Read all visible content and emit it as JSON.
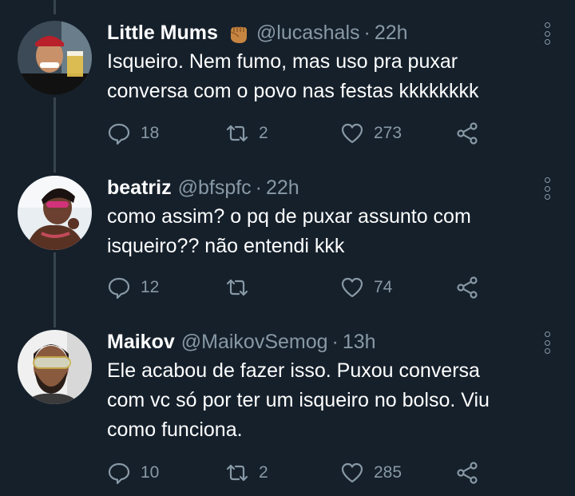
{
  "colors": {
    "background": "#15202b",
    "secondary_text": "#8899a6",
    "thread_line": "#38444d",
    "primary_text": "#ffffff"
  },
  "tweets": [
    {
      "name": "Little Mums",
      "badge_icon": "raised-fist-emoji",
      "handle": "@lucashals",
      "separator": "·",
      "time": "22h",
      "lines": [
        "Isqueiro. Nem fumo, mas uso pra puxar",
        "conversa com o povo nas festas kkkkkkkk"
      ],
      "replies": "18",
      "retweets": "2",
      "likes": "273"
    },
    {
      "name": "beatriz",
      "handle": "@bfspfc",
      "separator": "·",
      "time": "22h",
      "lines": [
        "como assim? o pq de puxar assunto com",
        "isqueiro?? não entendi kkk"
      ],
      "replies": "12",
      "retweets": "",
      "likes": "74"
    },
    {
      "name": "Maikov",
      "handle": "@MaikovSemog",
      "separator": "·",
      "time": "13h",
      "lines": [
        "Ele acabou de fazer isso. Puxou conversa",
        "com vc só por ter um isqueiro no bolso. Viu",
        "como funciona."
      ],
      "replies": "10",
      "retweets": "2",
      "likes": "285"
    }
  ]
}
